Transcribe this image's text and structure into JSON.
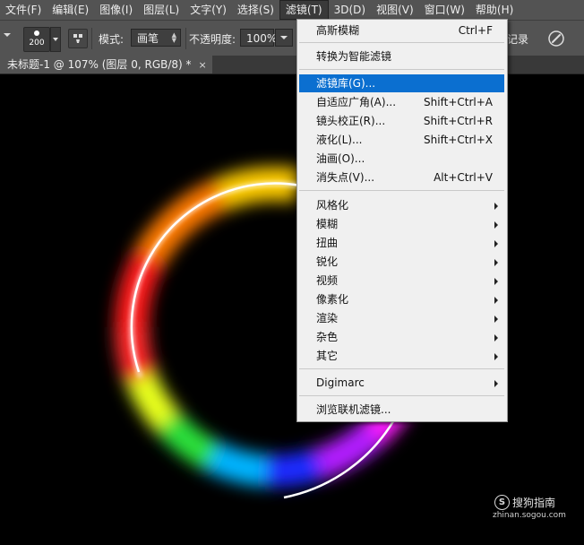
{
  "menubar": {
    "items": [
      "文件(F)",
      "编辑(E)",
      "图像(I)",
      "图层(L)",
      "文字(Y)",
      "选择(S)",
      "滤镜(T)",
      "3D(D)",
      "视图(V)",
      "窗口(W)",
      "帮助(H)"
    ],
    "active_index": 6
  },
  "options": {
    "brush_size": "200",
    "mode_label": "模式:",
    "mode_value": "画笔",
    "opacity_label": "不透明度:",
    "opacity_value": "100%",
    "history_label": "记录"
  },
  "document_tab": {
    "title": "未标题-1 @ 107% (图层 0, RGB/8) *",
    "close": "×"
  },
  "filter_menu": {
    "items": [
      {
        "label": "高斯模糊",
        "shortcut": "Ctrl+F"
      },
      {
        "label": "转换为智能滤镜"
      },
      {
        "label": "滤镜库(G)...",
        "highlighted": true
      },
      {
        "label": "自适应广角(A)...",
        "shortcut": "Shift+Ctrl+A"
      },
      {
        "label": "镜头校正(R)...",
        "shortcut": "Shift+Ctrl+R"
      },
      {
        "label": "液化(L)...",
        "shortcut": "Shift+Ctrl+X"
      },
      {
        "label": "油画(O)..."
      },
      {
        "label": "消失点(V)...",
        "shortcut": "Alt+Ctrl+V"
      },
      {
        "label": "风格化",
        "submenu": true
      },
      {
        "label": "模糊",
        "submenu": true
      },
      {
        "label": "扭曲",
        "submenu": true
      },
      {
        "label": "锐化",
        "submenu": true
      },
      {
        "label": "视频",
        "submenu": true
      },
      {
        "label": "像素化",
        "submenu": true
      },
      {
        "label": "渲染",
        "submenu": true
      },
      {
        "label": "杂色",
        "submenu": true
      },
      {
        "label": "其它",
        "submenu": true
      },
      {
        "label": "Digimarc",
        "submenu": true
      },
      {
        "label": "浏览联机滤镜..."
      }
    ]
  },
  "watermark": {
    "logo": "S",
    "name": "搜狗指南",
    "domain": "zhinan.sogou.com"
  },
  "colors": {
    "menubar": "#535353",
    "highlight": "#0b6fd0",
    "menu_bg": "#f0f0f0"
  }
}
